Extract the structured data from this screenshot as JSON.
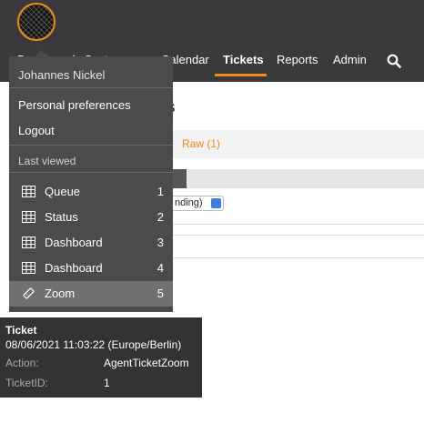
{
  "nav": {
    "items": [
      {
        "label": "Dashboard",
        "active": false
      },
      {
        "label": "Customers",
        "active": false
      },
      {
        "label": "Calendar",
        "active": false
      },
      {
        "label": "Tickets",
        "active": true
      },
      {
        "label": "Reports",
        "active": false
      },
      {
        "label": "Admin",
        "active": false
      }
    ],
    "accent_color": "#f08a1c",
    "search_icon": "search-icon"
  },
  "background": {
    "raw_link": "Raw (1)",
    "heading_fragment": "s",
    "strip_fragment": "0",
    "filter_value": "nding)"
  },
  "user_menu": {
    "user_name": "Johannes Nickel",
    "links": [
      "Personal preferences",
      "Logout"
    ],
    "section_label": "Last viewed",
    "last_viewed": [
      {
        "label": "Queue",
        "index": "1",
        "icon": "table-icon"
      },
      {
        "label": "Status",
        "index": "2",
        "icon": "table-icon"
      },
      {
        "label": "Dashboard",
        "index": "3",
        "icon": "table-icon"
      },
      {
        "label": "Dashboard",
        "index": "4",
        "icon": "table-icon"
      },
      {
        "label": "Zoom",
        "index": "5",
        "icon": "ticket-icon",
        "highlighted": true
      }
    ]
  },
  "tooltip": {
    "title": "Ticket",
    "datetime": "08/06/2021 11:03:22 (Europe/Berlin)",
    "rows": [
      {
        "key": "Action:",
        "value": "AgentTicketZoom"
      },
      {
        "key": "TicketID:",
        "value": "1"
      }
    ]
  }
}
